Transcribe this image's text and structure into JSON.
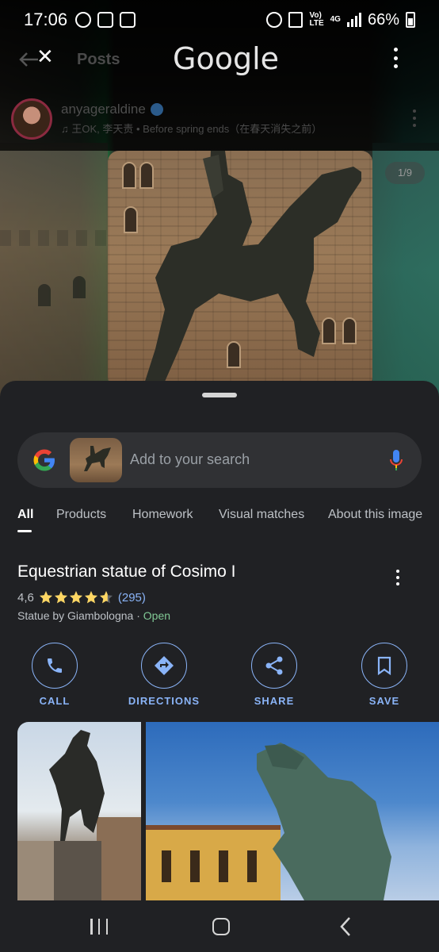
{
  "status_bar": {
    "time": "17:06",
    "battery": "66%",
    "network_label_1": "Vo)",
    "network_label_2": "LTE",
    "network_gen": "4G"
  },
  "header": {
    "posts_label": "Posts",
    "logo_text": "Google"
  },
  "post": {
    "username": "anyageraldine",
    "music_line": "王OK, 李天责 • Before spring ends（在春天消失之前）",
    "page_counter": "1/9"
  },
  "search": {
    "placeholder": "Add to your search"
  },
  "tabs": [
    "All",
    "Products",
    "Homework",
    "Visual matches",
    "About this image"
  ],
  "result": {
    "title": "Equestrian statue of Cosimo I",
    "rating": "4,6",
    "rating_stars": 4.6,
    "review_count": "(295)",
    "subtitle": "Statue by Giambologna",
    "separator": " · ",
    "open_status": "Open"
  },
  "actions": {
    "call": "CALL",
    "directions": "DIRECTIONS",
    "share": "SHARE",
    "save": "SAVE"
  },
  "colors": {
    "accent_blue": "#8ab4f8",
    "sheet_bg": "#202124",
    "star_yellow": "#fdd663",
    "open_green": "#81c995"
  }
}
